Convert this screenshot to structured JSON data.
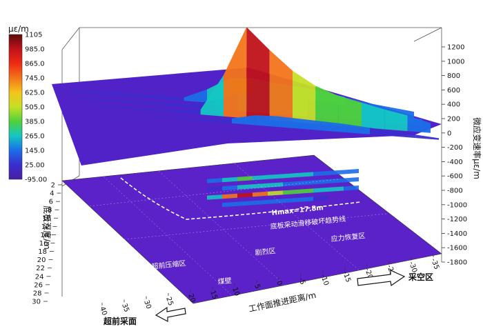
{
  "chart_data": {
    "type": "surface3d",
    "legend": {
      "unit": "με/m",
      "levels": [
        "1105",
        "985.0",
        "865.0",
        "745.0",
        "625.0",
        "505.0",
        "385.0",
        "265.0",
        "145.0",
        "25.00",
        "-95.00"
      ],
      "colors": [
        "#5b0b0b",
        "#c0121a",
        "#ef2a14",
        "#f3751a",
        "#f5c31c",
        "#c6df25",
        "#4fd13a",
        "#14c7c3",
        "#1b6ee8",
        "#3b2dcf",
        "#4a1fa0"
      ]
    },
    "z_axis": {
      "label": "微应变速率με/m",
      "ticks": [
        1200,
        1000,
        800,
        600,
        400,
        200,
        0,
        -200,
        -400,
        -600,
        -800,
        -1000,
        -1200,
        -1400,
        -1600,
        -1800
      ]
    },
    "y_axis": {
      "label": "底板深度/m",
      "ticks": [
        2,
        4,
        6,
        8,
        10,
        12,
        14,
        16,
        18,
        20,
        22,
        24,
        26,
        28,
        30
      ]
    },
    "x_axis": {
      "label": "工作面推进距离/m",
      "ticks": [
        40,
        35,
        30,
        25,
        20,
        15,
        10,
        5,
        0,
        -5,
        -10,
        -15,
        -20,
        -25,
        -30,
        -35
      ]
    },
    "annotations": {
      "hmax": "Hmax=17.8m",
      "trend_line": "底板采动滑移破坏趋势线",
      "zone_compress": "超前压缩区",
      "zone_intense": "剧烈区",
      "zone_recovery": "应力恢复区",
      "coal_wall": "煤壁",
      "goaf": "采空区",
      "advance_face": "超前采面"
    },
    "series": [
      {
        "depth": 4,
        "values": [
          20,
          25,
          30,
          30,
          35,
          40,
          160,
          320,
          340,
          300,
          280,
          250,
          200,
          150,
          120,
          90
        ]
      },
      {
        "depth": 8,
        "values": [
          10,
          15,
          20,
          20,
          30,
          40,
          120,
          220,
          240,
          230,
          210,
          190,
          170,
          140,
          110,
          80
        ]
      },
      {
        "depth": 12,
        "values": [
          5,
          10,
          15,
          20,
          30,
          60,
          500,
          1105,
          850,
          620,
          460,
          360,
          300,
          240,
          190,
          120
        ]
      },
      {
        "depth": 16,
        "values": [
          0,
          5,
          5,
          10,
          15,
          20,
          60,
          120,
          130,
          120,
          110,
          100,
          80,
          60,
          40,
          20
        ]
      }
    ]
  }
}
